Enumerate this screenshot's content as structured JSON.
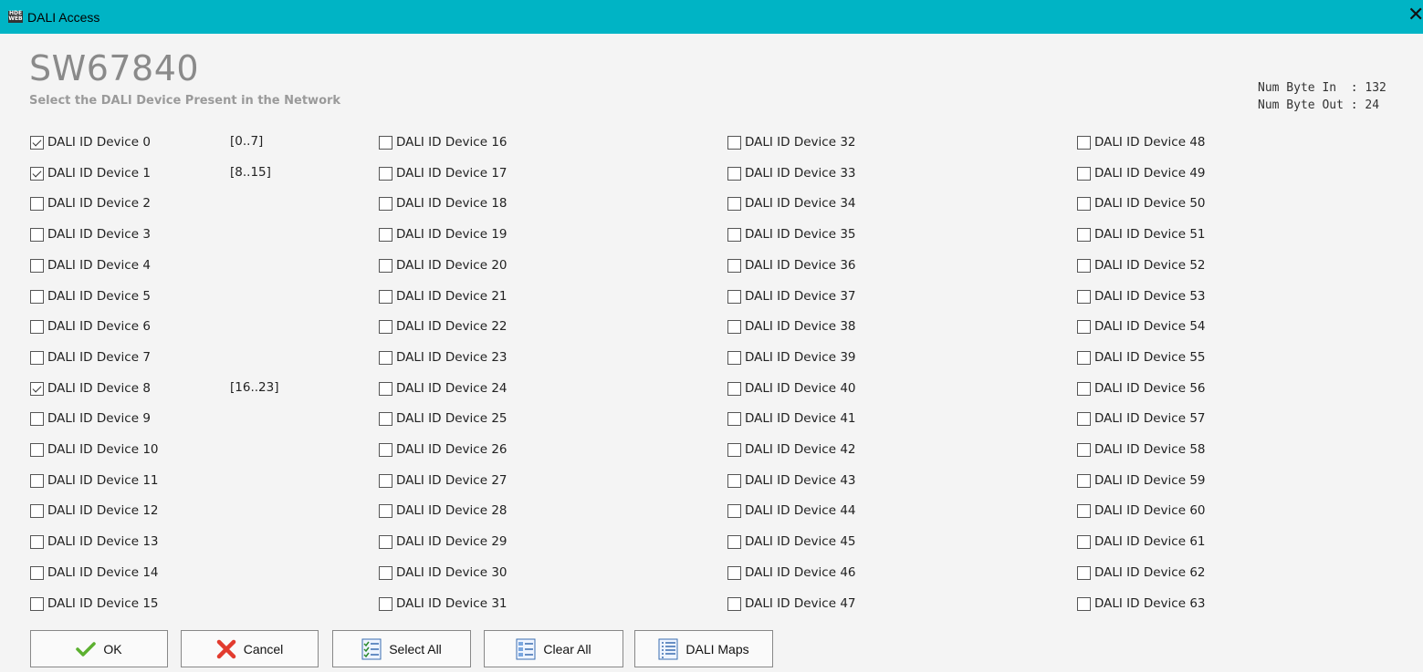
{
  "window": {
    "title": "DALI Access",
    "icon": "app-logo-icon",
    "close_glyph": "✕"
  },
  "header": {
    "product": "SW67840",
    "subtitle": "Select the DALI Device Present in the  Network"
  },
  "stats": {
    "num_byte_in": "Num Byte In  : 132",
    "num_byte_out": "Num Byte Out : 24"
  },
  "devices": [
    {
      "label": "DALI ID Device 0",
      "checked": true,
      "range": "[0..7]"
    },
    {
      "label": "DALI ID Device 1",
      "checked": true,
      "range": "[8..15]"
    },
    {
      "label": "DALI ID Device 2",
      "checked": false
    },
    {
      "label": "DALI ID Device 3",
      "checked": false
    },
    {
      "label": "DALI ID Device 4",
      "checked": false
    },
    {
      "label": "DALI ID Device 5",
      "checked": false
    },
    {
      "label": "DALI ID Device 6",
      "checked": false
    },
    {
      "label": "DALI ID Device 7",
      "checked": false
    },
    {
      "label": "DALI ID Device 8",
      "checked": true,
      "range": "[16..23]"
    },
    {
      "label": "DALI ID Device 9",
      "checked": false
    },
    {
      "label": "DALI ID Device 10",
      "checked": false
    },
    {
      "label": "DALI ID Device 11",
      "checked": false
    },
    {
      "label": "DALI ID Device 12",
      "checked": false
    },
    {
      "label": "DALI ID Device 13",
      "checked": false
    },
    {
      "label": "DALI ID Device 14",
      "checked": false
    },
    {
      "label": "DALI ID Device 15",
      "checked": false
    },
    {
      "label": "DALI ID Device 16",
      "checked": false
    },
    {
      "label": "DALI ID Device 17",
      "checked": false
    },
    {
      "label": "DALI ID Device 18",
      "checked": false
    },
    {
      "label": "DALI ID Device 19",
      "checked": false
    },
    {
      "label": "DALI ID Device 20",
      "checked": false
    },
    {
      "label": "DALI ID Device 21",
      "checked": false
    },
    {
      "label": "DALI ID Device 22",
      "checked": false
    },
    {
      "label": "DALI ID Device 23",
      "checked": false
    },
    {
      "label": "DALI ID Device 24",
      "checked": false
    },
    {
      "label": "DALI ID Device 25",
      "checked": false
    },
    {
      "label": "DALI ID Device 26",
      "checked": false
    },
    {
      "label": "DALI ID Device 27",
      "checked": false
    },
    {
      "label": "DALI ID Device 28",
      "checked": false
    },
    {
      "label": "DALI ID Device 29",
      "checked": false
    },
    {
      "label": "DALI ID Device 30",
      "checked": false
    },
    {
      "label": "DALI ID Device 31",
      "checked": false
    },
    {
      "label": "DALI ID Device 32",
      "checked": false
    },
    {
      "label": "DALI ID Device 33",
      "checked": false
    },
    {
      "label": "DALI ID Device 34",
      "checked": false
    },
    {
      "label": "DALI ID Device 35",
      "checked": false
    },
    {
      "label": "DALI ID Device 36",
      "checked": false
    },
    {
      "label": "DALI ID Device 37",
      "checked": false
    },
    {
      "label": "DALI ID Device 38",
      "checked": false
    },
    {
      "label": "DALI ID Device 39",
      "checked": false
    },
    {
      "label": "DALI ID Device 40",
      "checked": false
    },
    {
      "label": "DALI ID Device 41",
      "checked": false
    },
    {
      "label": "DALI ID Device 42",
      "checked": false
    },
    {
      "label": "DALI ID Device 43",
      "checked": false
    },
    {
      "label": "DALI ID Device 44",
      "checked": false
    },
    {
      "label": "DALI ID Device 45",
      "checked": false
    },
    {
      "label": "DALI ID Device 46",
      "checked": false
    },
    {
      "label": "DALI ID Device 47",
      "checked": false
    },
    {
      "label": "DALI ID Device 48",
      "checked": false
    },
    {
      "label": "DALI ID Device 49",
      "checked": false
    },
    {
      "label": "DALI ID Device 50",
      "checked": false
    },
    {
      "label": "DALI ID Device 51",
      "checked": false
    },
    {
      "label": "DALI ID Device 52",
      "checked": false
    },
    {
      "label": "DALI ID Device 53",
      "checked": false
    },
    {
      "label": "DALI ID Device 54",
      "checked": false
    },
    {
      "label": "DALI ID Device 55",
      "checked": false
    },
    {
      "label": "DALI ID Device 56",
      "checked": false
    },
    {
      "label": "DALI ID Device 57",
      "checked": false
    },
    {
      "label": "DALI ID Device 58",
      "checked": false
    },
    {
      "label": "DALI ID Device 59",
      "checked": false
    },
    {
      "label": "DALI ID Device 60",
      "checked": false
    },
    {
      "label": "DALI ID Device 61",
      "checked": false
    },
    {
      "label": "DALI ID Device 62",
      "checked": false
    },
    {
      "label": "DALI ID Device 63",
      "checked": false
    }
  ],
  "buttons": {
    "ok": {
      "label": "OK",
      "icon": "checkmark-icon"
    },
    "cancel": {
      "label": "Cancel",
      "icon": "red-x-icon"
    },
    "select_all": {
      "label": "Select All",
      "icon": "select-all-list-icon"
    },
    "clear_all": {
      "label": "Clear All",
      "icon": "clear-all-list-icon"
    },
    "dali_maps": {
      "label": "DALI Maps",
      "icon": "list-icon"
    }
  },
  "colors": {
    "titlebar": "#00b4c5",
    "background": "#f4f4f4",
    "title_text": "#8a8a8a"
  }
}
